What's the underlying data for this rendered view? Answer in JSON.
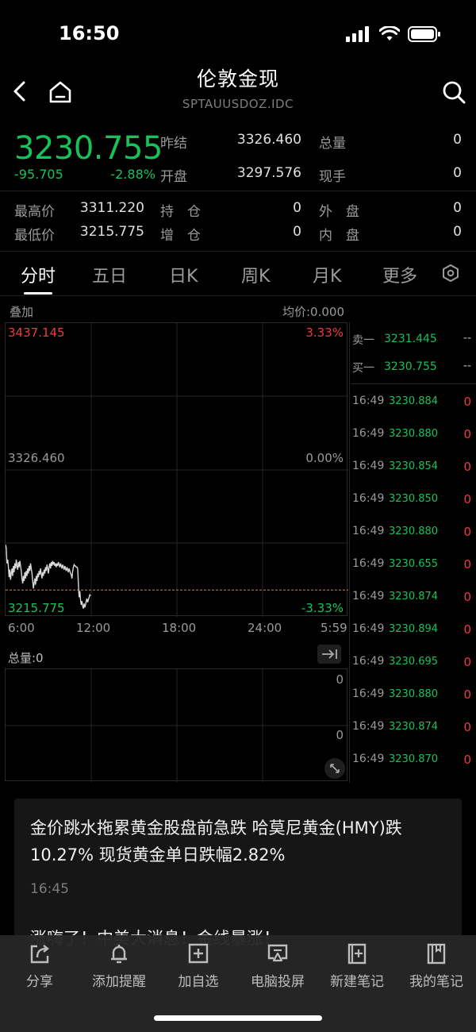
{
  "status_bar": {
    "time": "16:50"
  },
  "header": {
    "title": "伦敦金现",
    "subtitle": "SPTAUUSDOZ.IDC"
  },
  "quote": {
    "price": "3230.755",
    "change": "-95.705",
    "change_pct": "-2.88%",
    "prev_close_label": "昨结",
    "prev_close": "3326.460",
    "open_label": "开盘",
    "open": "3297.576",
    "total_vol_label": "总量",
    "total_vol": "0",
    "cur_vol_label": "现手",
    "cur_vol": "0",
    "high_label": "最高价",
    "high": "3311.220",
    "low_label": "最低价",
    "low": "3215.775",
    "oi_label": "持　仓",
    "oi": "0",
    "oi_chg_label": "增　仓",
    "oi_chg": "0",
    "outer_label": "外　盘",
    "outer": "0",
    "inner_label": "内　盘",
    "inner": "0"
  },
  "tabs": [
    {
      "label": "分时"
    },
    {
      "label": "五日"
    },
    {
      "label": "日K"
    },
    {
      "label": "周K"
    },
    {
      "label": "月K"
    },
    {
      "label": "更多"
    }
  ],
  "chart": {
    "overlay_label": "叠加",
    "avg_label": "均价:0.000",
    "y_top": "3437.145",
    "y_mid": "3326.460",
    "y_bot": "3215.775",
    "pct_top": "3.33%",
    "pct_mid": "0.00%",
    "pct_bot": "-3.33%",
    "x_labels": [
      "6:00",
      "12:00",
      "18:00",
      "24:00",
      "5:59"
    ],
    "total_vol_label": "总量:0",
    "vol_top": "0",
    "vol_mid": "0"
  },
  "chart_data": {
    "type": "line",
    "ylim": [
      3215.775,
      3437.145
    ],
    "reference": 3326.46,
    "current": 3230.755,
    "x_range": [
      0,
      1440
    ],
    "points": [
      [
        0,
        3267
      ],
      [
        3,
        3264
      ],
      [
        6,
        3252
      ],
      [
        9,
        3255
      ],
      [
        12,
        3249
      ],
      [
        15,
        3241
      ],
      [
        18,
        3247
      ],
      [
        21,
        3239
      ],
      [
        24,
        3244
      ],
      [
        27,
        3248
      ],
      [
        30,
        3242
      ],
      [
        33,
        3250
      ],
      [
        36,
        3245
      ],
      [
        39,
        3252
      ],
      [
        42,
        3248
      ],
      [
        45,
        3255
      ],
      [
        48,
        3250
      ],
      [
        51,
        3247
      ],
      [
        54,
        3253
      ],
      [
        57,
        3249
      ],
      [
        60,
        3254
      ],
      [
        63,
        3250
      ],
      [
        66,
        3246
      ],
      [
        69,
        3240
      ],
      [
        72,
        3236
      ],
      [
        75,
        3242
      ],
      [
        78,
        3238
      ],
      [
        81,
        3245
      ],
      [
        84,
        3240
      ],
      [
        87,
        3246
      ],
      [
        90,
        3242
      ],
      [
        93,
        3248
      ],
      [
        96,
        3244
      ],
      [
        99,
        3250
      ],
      [
        102,
        3246
      ],
      [
        105,
        3252
      ],
      [
        108,
        3248
      ],
      [
        111,
        3244
      ],
      [
        114,
        3238
      ],
      [
        117,
        3232
      ],
      [
        120,
        3236
      ],
      [
        123,
        3240
      ],
      [
        126,
        3235
      ],
      [
        129,
        3242
      ],
      [
        132,
        3238
      ],
      [
        135,
        3244
      ],
      [
        138,
        3241
      ],
      [
        141,
        3246
      ],
      [
        144,
        3243
      ],
      [
        147,
        3248
      ],
      [
        150,
        3244
      ],
      [
        153,
        3240
      ],
      [
        156,
        3245
      ],
      [
        159,
        3242
      ],
      [
        162,
        3247
      ],
      [
        165,
        3244
      ],
      [
        168,
        3249
      ],
      [
        171,
        3246
      ],
      [
        174,
        3251
      ],
      [
        177,
        3248
      ],
      [
        180,
        3244
      ],
      [
        183,
        3249
      ],
      [
        186,
        3252
      ],
      [
        189,
        3248
      ],
      [
        192,
        3253
      ],
      [
        195,
        3250
      ],
      [
        198,
        3254
      ],
      [
        201,
        3251
      ],
      [
        204,
        3253
      ],
      [
        207,
        3250
      ],
      [
        210,
        3252
      ],
      [
        213,
        3249
      ],
      [
        216,
        3252
      ],
      [
        219,
        3250
      ],
      [
        222,
        3253
      ],
      [
        225,
        3251
      ],
      [
        228,
        3249
      ],
      [
        231,
        3252
      ],
      [
        234,
        3250
      ],
      [
        237,
        3248
      ],
      [
        240,
        3251
      ],
      [
        243,
        3249
      ],
      [
        246,
        3247
      ],
      [
        249,
        3250
      ],
      [
        252,
        3248
      ],
      [
        255,
        3246
      ],
      [
        258,
        3249
      ],
      [
        261,
        3247
      ],
      [
        264,
        3245
      ],
      [
        267,
        3248
      ],
      [
        270,
        3246
      ],
      [
        273,
        3244
      ],
      [
        276,
        3243
      ],
      [
        279,
        3240
      ],
      [
        282,
        3246
      ],
      [
        285,
        3249
      ],
      [
        288,
        3251
      ],
      [
        291,
        3250
      ],
      [
        294,
        3250
      ],
      [
        297,
        3249
      ],
      [
        300,
        3249
      ],
      [
        303,
        3248
      ],
      [
        306,
        3236
      ],
      [
        309,
        3225
      ],
      [
        312,
        3230
      ],
      [
        315,
        3223
      ],
      [
        318,
        3219
      ],
      [
        321,
        3222
      ],
      [
        324,
        3218
      ],
      [
        327,
        3216
      ],
      [
        330,
        3220
      ],
      [
        333,
        3217
      ],
      [
        336,
        3219
      ],
      [
        339,
        3222
      ],
      [
        342,
        3224
      ],
      [
        345,
        3221
      ],
      [
        348,
        3223
      ],
      [
        351,
        3225
      ],
      [
        354,
        3227
      ],
      [
        357,
        3226
      ]
    ]
  },
  "orderbook": {
    "sell_label": "卖一",
    "sell_price": "3231.445",
    "sell_vol": "--",
    "buy_label": "买一",
    "buy_price": "3230.755",
    "buy_vol": "--"
  },
  "trades": [
    {
      "time": "16:49",
      "price": "3230.884",
      "vol": "0"
    },
    {
      "time": "16:49",
      "price": "3230.880",
      "vol": "0"
    },
    {
      "time": "16:49",
      "price": "3230.854",
      "vol": "0"
    },
    {
      "time": "16:49",
      "price": "3230.850",
      "vol": "0"
    },
    {
      "time": "16:49",
      "price": "3230.880",
      "vol": "0"
    },
    {
      "time": "16:49",
      "price": "3230.655",
      "vol": "0"
    },
    {
      "time": "16:49",
      "price": "3230.874",
      "vol": "0"
    },
    {
      "time": "16:49",
      "price": "3230.894",
      "vol": "0"
    },
    {
      "time": "16:49",
      "price": "3230.695",
      "vol": "0"
    },
    {
      "time": "16:49",
      "price": "3230.880",
      "vol": "0"
    },
    {
      "time": "16:49",
      "price": "3230.874",
      "vol": "0"
    },
    {
      "time": "16:49",
      "price": "3230.870",
      "vol": "0"
    }
  ],
  "news": [
    {
      "title": "金价跳水拖累黄金股盘前急跌 哈莫尼黄金(HMY)跌10.27% 现货黄金单日跌幅2.82%",
      "time": "16:45"
    },
    {
      "title": "涨嗨了！中美大消息！金线暴涨！"
    }
  ],
  "bottom_bar": [
    {
      "label": "分享",
      "icon": "share-icon"
    },
    {
      "label": "添加提醒",
      "icon": "bell-icon"
    },
    {
      "label": "加自选",
      "icon": "plus-square-icon"
    },
    {
      "label": "电脑投屏",
      "icon": "cast-icon"
    },
    {
      "label": "新建笔记",
      "icon": "new-note-icon"
    },
    {
      "label": "我的笔记",
      "icon": "notebook-icon"
    }
  ]
}
